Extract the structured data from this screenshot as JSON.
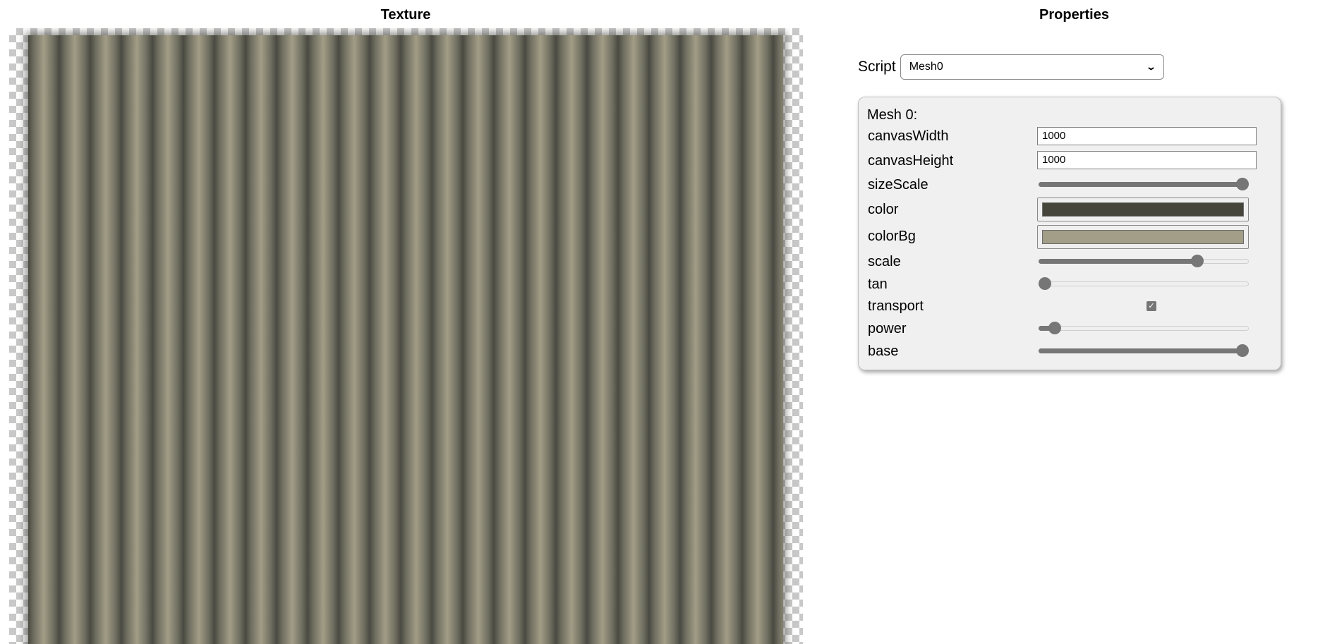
{
  "texture": {
    "title": "Texture",
    "stripe_colors": [
      "#4a4a42",
      "#a29d86"
    ]
  },
  "properties": {
    "title": "Properties",
    "script": {
      "label": "Script",
      "selected": "Mesh0",
      "chevron_icon": "chevron-down-icon"
    },
    "mesh": {
      "title": "Mesh 0:",
      "canvasWidth": {
        "label": "canvasWidth",
        "value": "1000"
      },
      "canvasHeight": {
        "label": "canvasHeight",
        "value": "1000"
      },
      "sizeScale": {
        "label": "sizeScale",
        "fraction": 1.0
      },
      "color": {
        "label": "color",
        "value": "#45453c"
      },
      "colorBg": {
        "label": "colorBg",
        "value": "#a29e87"
      },
      "scale": {
        "label": "scale",
        "fraction": 0.77
      },
      "tan": {
        "label": "tan",
        "fraction": 0.0
      },
      "transport": {
        "label": "transport",
        "checked": true
      },
      "power": {
        "label": "power",
        "fraction": 0.05
      },
      "base": {
        "label": "base",
        "fraction": 1.0
      }
    }
  }
}
